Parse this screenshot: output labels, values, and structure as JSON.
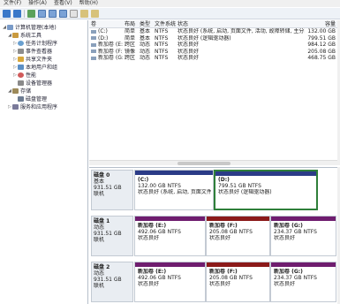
{
  "menubar": {
    "items": [
      "文件(F)",
      "操作(A)",
      "查看(V)",
      "帮助(H)"
    ]
  },
  "tree": [
    {
      "label": "计算机管理(本地)",
      "indent": 0,
      "icon": "computer-icon",
      "iconClass": "computer",
      "toggle": "◢"
    },
    {
      "label": "系统工具",
      "indent": 1,
      "icon": "tools-icon",
      "iconClass": "tools",
      "toggle": "◢"
    },
    {
      "label": "任务计划程序",
      "indent": 2,
      "icon": "clock-icon",
      "iconClass": "clock",
      "toggle": "▷"
    },
    {
      "label": "事件查看器",
      "indent": 2,
      "icon": "event-viewer-icon",
      "iconClass": "viewer",
      "toggle": "▷"
    },
    {
      "label": "共享文件夹",
      "indent": 2,
      "icon": "shared-folder-icon",
      "iconClass": "share",
      "toggle": "▷"
    },
    {
      "label": "本地用户和组",
      "indent": 2,
      "icon": "users-icon",
      "iconClass": "users",
      "toggle": "▷"
    },
    {
      "label": "性能",
      "indent": 2,
      "icon": "performance-icon",
      "iconClass": "perf",
      "toggle": "▷"
    },
    {
      "label": "设备管理器",
      "indent": 2,
      "icon": "device-manager-icon",
      "iconClass": "device",
      "toggle": ""
    },
    {
      "label": "存储",
      "indent": 1,
      "icon": "storage-icon",
      "iconClass": "storage",
      "toggle": "◢"
    },
    {
      "label": "磁盘管理",
      "indent": 2,
      "icon": "disk-management-icon",
      "iconClass": "disk",
      "toggle": ""
    },
    {
      "label": "服务和应用程序",
      "indent": 1,
      "icon": "services-icon",
      "iconClass": "service",
      "toggle": "▷"
    }
  ],
  "volumes": {
    "headers": [
      "卷",
      "布局",
      "类型",
      "文件系统",
      "状态",
      "容量"
    ],
    "rows": [
      [
        "(C:)",
        "简单",
        "基本",
        "NTFS",
        "状态良好 (系统, 启动, 页面文件, 活动, 故障转储, 主分区)",
        "132.00 GB"
      ],
      [
        "(D:)",
        "简单",
        "基本",
        "NTFS",
        "状态良好 (逻辑驱动器)",
        "799.51 GB"
      ],
      [
        "新加卷 (E:)",
        "跨区",
        "动态",
        "NTFS",
        "状态良好",
        "984.12 GB"
      ],
      [
        "新加卷 (F:)",
        "镜像",
        "动态",
        "NTFS",
        "状态良好",
        "205.08 GB"
      ],
      [
        "新加卷 (G:)",
        "跨区",
        "动态",
        "NTFS",
        "状态良好",
        "468.75 GB"
      ]
    ]
  },
  "disks": [
    {
      "title": "磁盘 0",
      "type": "基本",
      "size": "931.51 GB",
      "state": "联机",
      "partitions": [
        {
          "name": "(C:)",
          "size": "132.00 GB NTFS",
          "status": "状态良好 (系统, 启动, 页面文件, 活动",
          "bar": "#2b3b87",
          "width": 90,
          "selected": false
        },
        {
          "name": "(D:)",
          "size": "799.51 GB NTFS",
          "status": "状态良好 (逻辑驱动器)",
          "bar": "#2b3b87",
          "width": 118,
          "selected": true
        }
      ]
    },
    {
      "title": "磁盘 1",
      "type": "动态",
      "size": "931.51 GB",
      "state": "联机",
      "partitions": [
        {
          "name": "新加卷  (E:)",
          "size": "492.06 GB NTFS",
          "status": "状态良好",
          "bar": "#6f1d6f",
          "width": 81,
          "selected": false
        },
        {
          "name": "新加卷  (F:)",
          "size": "205.08 GB NTFS",
          "status": "状态良好",
          "bar": "#8b1a1a",
          "width": 73,
          "selected": false
        },
        {
          "name": "新加卷  (G:)",
          "size": "234.37 GB NTFS",
          "status": "状态良好",
          "bar": "#6f1d6f",
          "width": 75,
          "selected": false
        }
      ]
    },
    {
      "title": "磁盘 2",
      "type": "动态",
      "size": "931.51 GB",
      "state": "联机",
      "partitions": [
        {
          "name": "新加卷  (E:)",
          "size": "492.06 GB NTFS",
          "status": "状态良好",
          "bar": "#6f1d6f",
          "width": 81,
          "selected": false
        },
        {
          "name": "新加卷  (F:)",
          "size": "205.08 GB NTFS",
          "status": "状态良好",
          "bar": "#8b1a1a",
          "width": 73,
          "selected": false
        },
        {
          "name": "新加卷  (G:)",
          "size": "234.37 GB NTFS",
          "status": "状态良好",
          "bar": "#6f1d6f",
          "width": 75,
          "selected": false
        }
      ]
    }
  ]
}
